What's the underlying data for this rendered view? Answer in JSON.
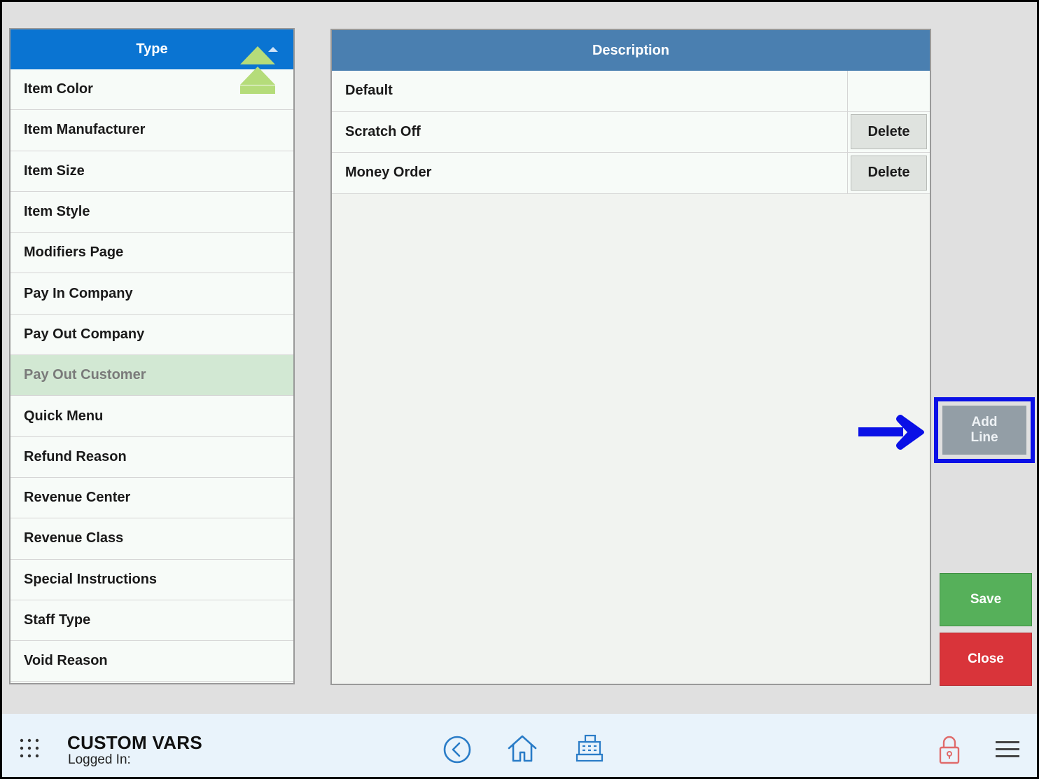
{
  "type_list": {
    "header": "Type",
    "items": [
      "Item Color",
      "Item Manufacturer",
      "Item Size",
      "Item Style",
      "Modifiers Page",
      "Pay In Company",
      "Pay Out Company",
      "Pay Out Customer",
      "Quick Menu",
      "Refund Reason",
      "Revenue Center",
      "Revenue Class",
      "Special Instructions",
      "Staff Type",
      "Void Reason"
    ],
    "selected": "Pay Out Customer"
  },
  "description_list": {
    "header": "Description",
    "rows": [
      {
        "text": "Default",
        "action": ""
      },
      {
        "text": "Scratch Off",
        "action": "Delete"
      },
      {
        "text": "Money Order",
        "action": "Delete"
      }
    ]
  },
  "buttons": {
    "add_line": "Add\nLine",
    "save": "Save",
    "close": "Close"
  },
  "footer": {
    "title": "CUSTOM VARS",
    "subtitle": "Logged In:"
  },
  "colors": {
    "type_header": "#0a74d2",
    "desc_header": "#4a7fb0",
    "selected_row": "#d2e8d3",
    "save": "#56b05a",
    "close": "#d9343a",
    "highlight": "#0a10e6"
  },
  "icons": {
    "scroll": "double-chevron-up-icon",
    "apps": "apps-grid-icon",
    "back": "back-circle-icon",
    "home": "home-icon",
    "register": "cash-register-icon",
    "lock": "lock-icon",
    "menu": "hamburger-menu-icon"
  }
}
